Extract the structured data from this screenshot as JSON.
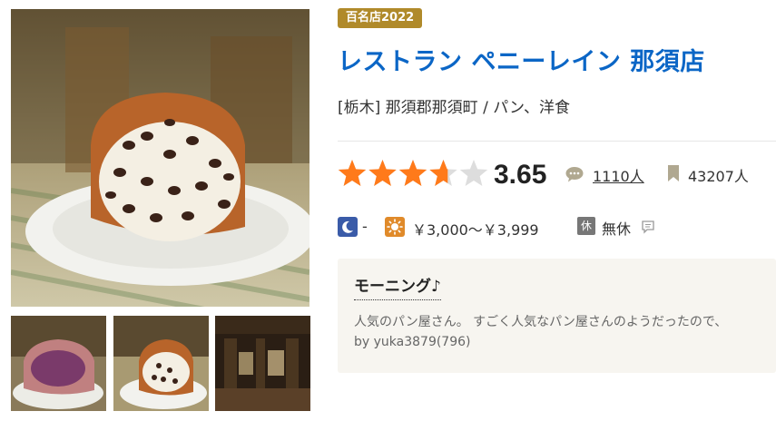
{
  "badge": "百名店2022",
  "restaurant_name": "レストラン ペニーレイン 那須店",
  "area": "[栃木] 那須郡那須町 / パン、洋食",
  "rating": {
    "stars": 3.65,
    "score": "3.65",
    "review_count": "1110人",
    "save_count": "43207人"
  },
  "price": {
    "dinner": "-",
    "lunch": "￥3,000～￥3,999"
  },
  "holiday": {
    "icon_label": "休",
    "text": "無休"
  },
  "review": {
    "title": "モーニング♪",
    "excerpt": "人気のパン屋さん。 すごく人気なパン屋さんのようだったので、",
    "author": "by yuka3879(796)"
  },
  "colors": {
    "title_blue": "#0b66c6",
    "badge_gold": "#b08a2a",
    "star_orange": "#ff7a1a",
    "star_empty": "#dddddd",
    "dinner_blue": "#3a5ba8",
    "lunch_orange": "#e08a2a"
  },
  "icons": {
    "review": "speech-bubble-icon",
    "bookmark": "bookmark-icon",
    "dinner": "moon-icon",
    "lunch": "sun-icon",
    "holiday_detail": "comment-icon"
  }
}
